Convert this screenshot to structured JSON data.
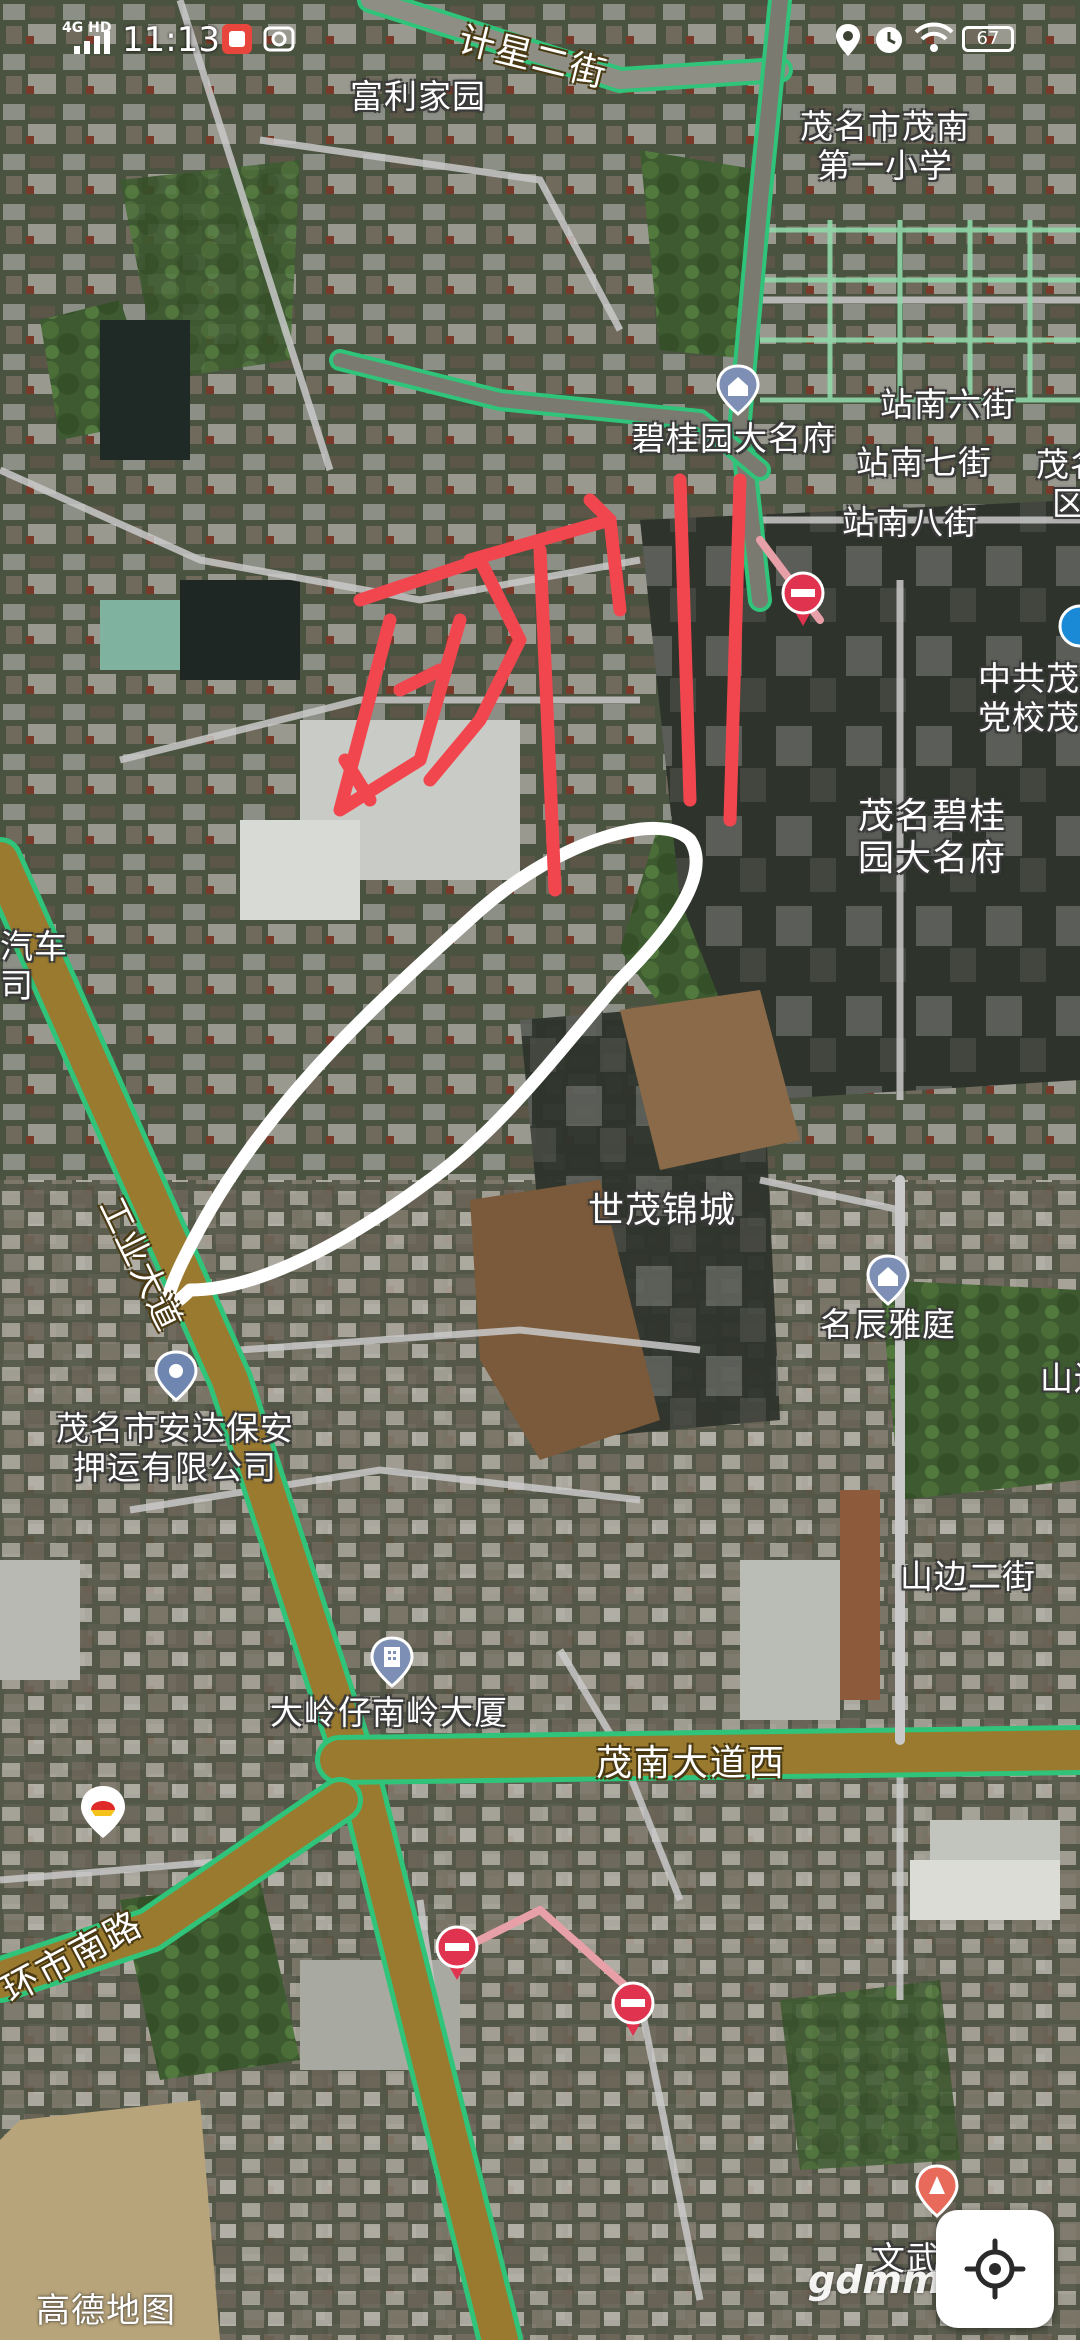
{
  "status_bar": {
    "time": "11:13",
    "network": "4G HD",
    "battery": "67"
  },
  "map": {
    "provider_logo": "高德地图",
    "watermark": "gdmm.com",
    "colors": {
      "road_main": "#9a7a2f",
      "road_edge": "#30c47a",
      "road_minor": "#c9c9c9",
      "restricted_marker": "#e0334f",
      "drawn_red": "#f2464f",
      "drawn_white": "#ffffff",
      "poi_blue": "#7d8fb5"
    },
    "poi_labels": {
      "fuli_jiayuan": "富利家园",
      "school_line1": "茂名市茂南",
      "school_line2": "第一小学",
      "biguiyuan_daming": "碧桂园大名府",
      "zhannan6": "站南六街",
      "zhannan7": "站南七街",
      "zhannan8": "站南八街",
      "mao_edge_line1": "茂名",
      "mao_edge_line2": "区",
      "party_school_line1": "中共茂",
      "party_school_line2": "党校茂",
      "maoming_bgy_line1": "茂名碧桂",
      "maoming_bgy_line2": "园大名府",
      "auto_line1": "汽车",
      "auto_line2": "司",
      "shimao_jincheng": "世茂锦城",
      "mingchen_yating": "名辰雅庭",
      "shan_edge": "山边",
      "anda_line1": "茂名市安达保安",
      "anda_line2": "押运有限公司",
      "shanbian_er": "山边二街",
      "daling_building": "大岭仔南岭大厦",
      "wenwu": "文武"
    },
    "road_labels": {
      "jixing_er": "计星二街",
      "gongye_dadao": "工业大道",
      "maonan_dadao_xi": "茂南大道西",
      "huanshi_nanlu": "环市南路"
    },
    "annotations": {
      "red_scribble": "断了",
      "white_loop": "loop"
    },
    "icons": [
      "signal-icon",
      "notification-icon",
      "camera-icon",
      "location-icon",
      "alarm-icon",
      "wifi-icon",
      "battery-icon",
      "poi-pin-icon",
      "building-icon",
      "gas-station-icon",
      "no-entry-icon",
      "locate-icon"
    ]
  }
}
